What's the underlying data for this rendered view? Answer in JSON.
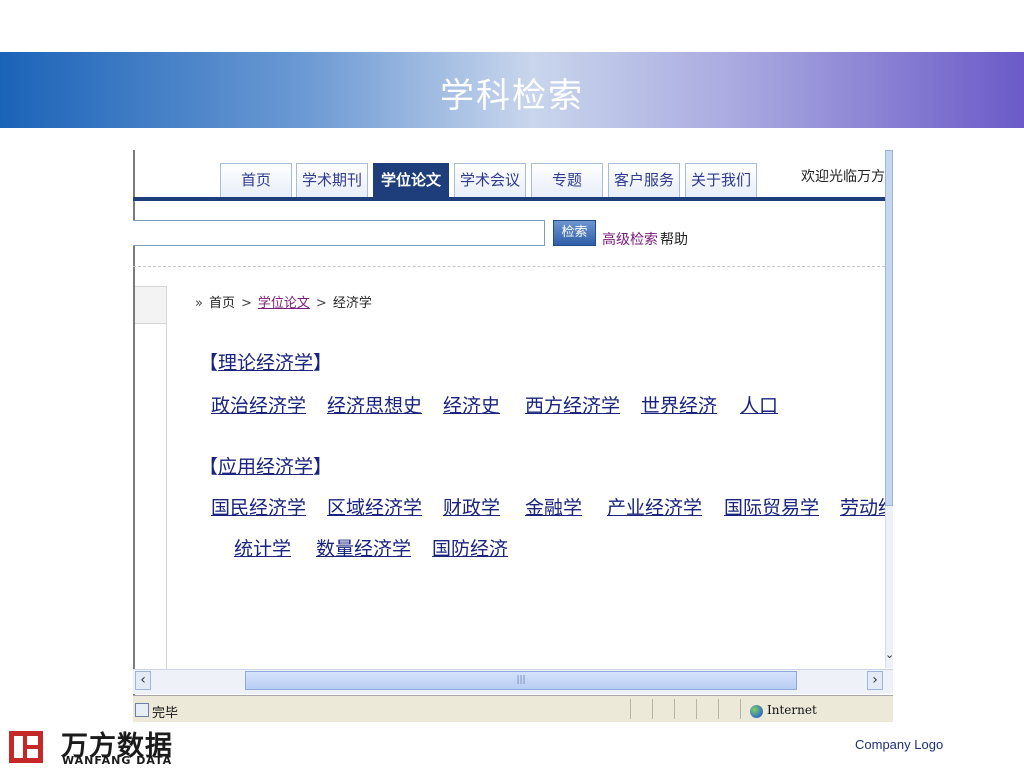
{
  "slide": {
    "title": "学科检索",
    "footer_logo_cn": "万方数据",
    "footer_logo_en": "WANFANG DATA",
    "company_logo": "Company Logo"
  },
  "browser": {
    "nav_tabs": [
      {
        "label": "首页",
        "active": false
      },
      {
        "label": "学术期刊",
        "active": false
      },
      {
        "label": "学位论文",
        "active": true
      },
      {
        "label": "学术会议",
        "active": false
      },
      {
        "label": "专题",
        "active": false
      },
      {
        "label": "客户服务",
        "active": false
      },
      {
        "label": "关于我们",
        "active": false
      }
    ],
    "welcome": "欢迎光临万方数",
    "search": {
      "value": "",
      "button_label": "检索",
      "advanced_label": "高级检索",
      "help_label": "帮助"
    },
    "breadcrumb": {
      "prefix": "»",
      "items": [
        "首页",
        "学位论文",
        "经济学"
      ],
      "separator": ">"
    },
    "categories": [
      {
        "bracket_open": "【",
        "name": "理论经济学",
        "bracket_close": "】",
        "links": [
          "政治经济学",
          "经济思想史",
          "经济史",
          "西方经济学",
          "世界经济",
          "人口"
        ]
      },
      {
        "bracket_open": "【",
        "name": "应用经济学",
        "bracket_close": "】",
        "links": [
          "国民经济学",
          "区域经济学",
          "财政学",
          "金融学",
          "产业经济学",
          "国际贸易学",
          "劳动经",
          "统计学",
          "数量经济学",
          "国防经济"
        ]
      }
    ],
    "status": {
      "text": "完毕",
      "zone": "Internet"
    },
    "colors": {
      "nav_active": "#1d3e7a",
      "link": "#1a237e",
      "visited": "#7a1a7a"
    }
  }
}
